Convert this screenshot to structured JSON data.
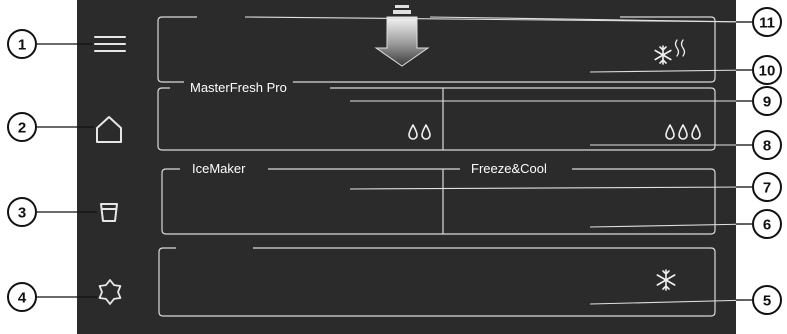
{
  "colors": {
    "screen_bg": "#2b2b2b",
    "line": "#d9d9d9",
    "callout_stroke": "#111111",
    "callout_fill": "#ffffff"
  },
  "panels": {
    "masterfresh_label": "MasterFresh Pro",
    "icemaker_label": "IceMaker",
    "freezecool_label": "Freeze&Cool"
  },
  "icons": {
    "menu": "hamburger-menu-icon",
    "home": "home-icon",
    "cup": "cup-icon",
    "favourite": "star-badge-icon",
    "arrow": "down-arrow-icon",
    "snowflake_steam": "snowflake-with-steam-icon",
    "drops_two": "two-drops-icon",
    "drops_three": "three-drops-icon",
    "snowflake": "snowflake-icon"
  },
  "callouts": [
    "1",
    "2",
    "3",
    "4",
    "5",
    "6",
    "7",
    "8",
    "9",
    "10",
    "11"
  ]
}
